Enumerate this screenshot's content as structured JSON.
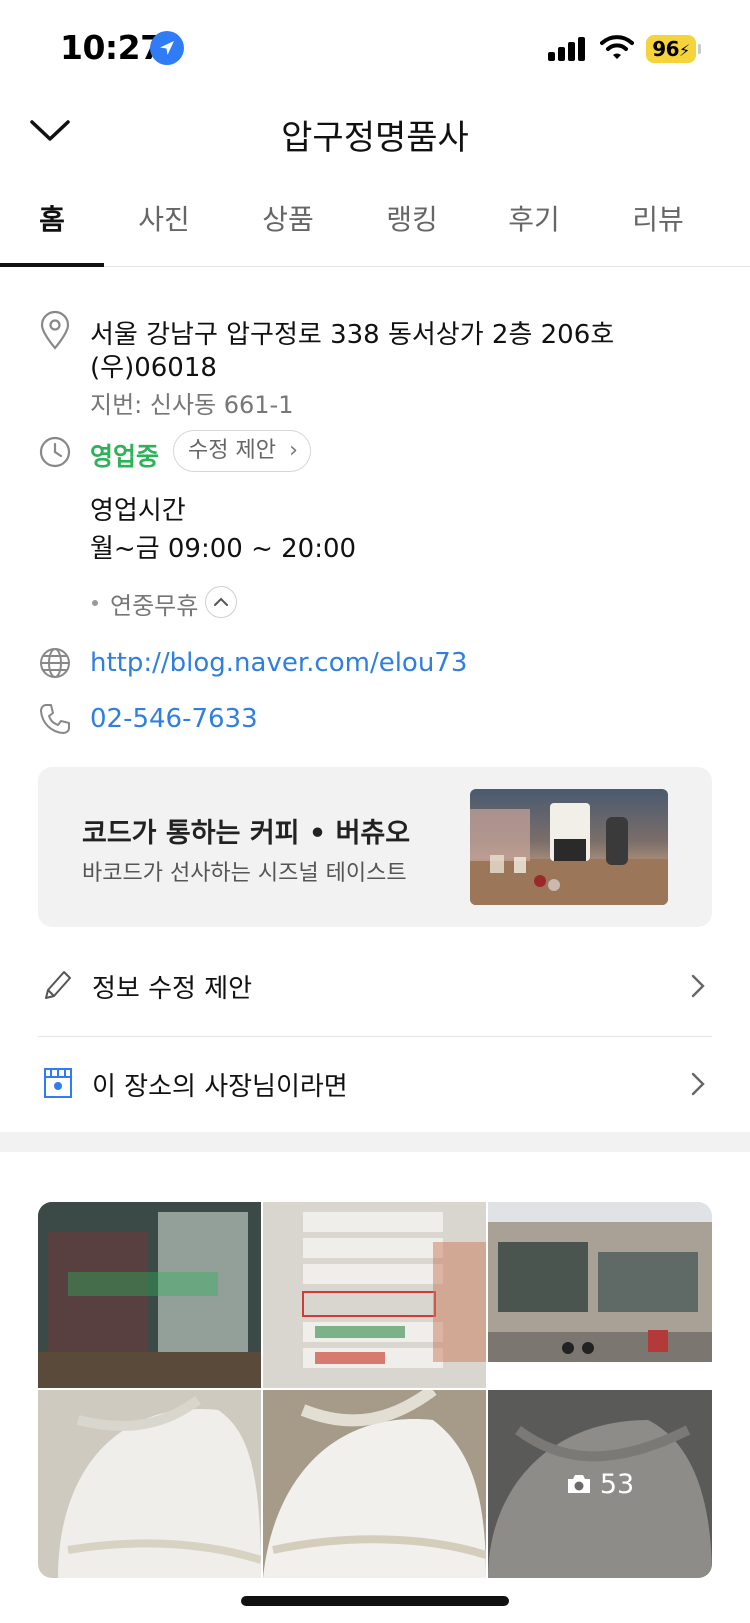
{
  "status_bar": {
    "time": "10:27",
    "battery": "96"
  },
  "header": {
    "title": "압구정명품사"
  },
  "tabs": [
    {
      "label": "홈",
      "active": true
    },
    {
      "label": "사진",
      "active": false
    },
    {
      "label": "상품",
      "active": false
    },
    {
      "label": "랭킹",
      "active": false
    },
    {
      "label": "후기",
      "active": false
    },
    {
      "label": "리뷰",
      "active": false
    }
  ],
  "info": {
    "address_line1": "서울 강남구 압구정로 338 동서상가 2층 206호",
    "address_postal": "(우)06018",
    "address_lot": "지번: 신사동 661-1",
    "open_status": "영업중",
    "suggest_edit": "수정 제안",
    "hours_label": "영업시간",
    "hours_value": "월~금 09:00 ~ 20:00",
    "holiday": "연중무휴",
    "website": "http://blog.naver.com/elou73",
    "phone": "02-546-7633"
  },
  "ad": {
    "title": "코드가 통하는 커피 • 버츄오",
    "subtitle": "바코드가 선사하는 시즈널 테이스트"
  },
  "actions": {
    "suggest_info_edit": "정보 수정 제안",
    "owner_link": "이 장소의 사장님이라면"
  },
  "photos": {
    "count": "53"
  },
  "colors": {
    "accent_green": "#2db259",
    "link_blue": "#2f7fe0",
    "location_blue": "#2f7cf6",
    "battery_yellow": "#f5d33a"
  }
}
